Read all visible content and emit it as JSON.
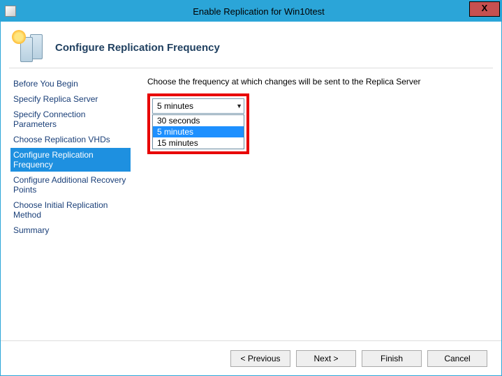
{
  "window": {
    "title": "Enable Replication for Win10test",
    "close": "X"
  },
  "header": {
    "title": "Configure Replication Frequency"
  },
  "sidebar": {
    "items": [
      {
        "label": "Before You Begin"
      },
      {
        "label": "Specify Replica Server"
      },
      {
        "label": "Specify Connection Parameters"
      },
      {
        "label": "Choose Replication VHDs"
      },
      {
        "label": "Configure Replication Frequency"
      },
      {
        "label": "Configure Additional Recovery Points"
      },
      {
        "label": "Choose Initial Replication Method"
      },
      {
        "label": "Summary"
      }
    ],
    "selected_index": 4
  },
  "main": {
    "instruction": "Choose the frequency at which changes will be sent to the Replica Server",
    "frequency_selected": "5 minutes",
    "frequency_options": [
      "30 seconds",
      "5 minutes",
      "15 minutes"
    ],
    "highlighted_option_index": 1
  },
  "footer": {
    "previous": "< Previous",
    "next": "Next >",
    "finish": "Finish",
    "cancel": "Cancel"
  }
}
